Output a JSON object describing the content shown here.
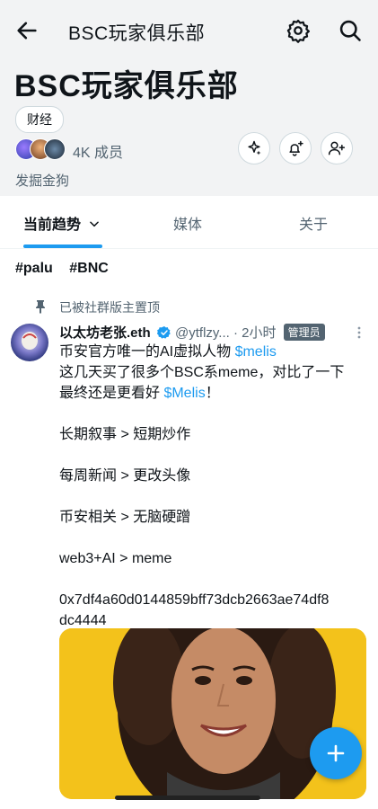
{
  "topbar": {
    "title": "BSC玩家俱乐部",
    "back_icon": "arrow-left-icon",
    "settings_icon": "gear-icon",
    "search_icon": "search-icon"
  },
  "community": {
    "name": "BSC玩家俱乐部",
    "tag": "财经",
    "members": "4K 成员",
    "description": "发掘金狗"
  },
  "tabs": [
    {
      "label": "当前趋势"
    },
    {
      "label": "媒体"
    },
    {
      "label": "关于"
    }
  ],
  "hashtags": [
    "#palu",
    "#BNC"
  ],
  "post": {
    "pinned_label": "已被社群版主置顶",
    "author": "以太坊老张.eth",
    "handle": "@ytflzy...",
    "time": "· 2小时",
    "badge": "管理员",
    "lines": {
      "l1_text": "币安官方唯一的AI虚拟人物 ",
      "l1_cashtag": "$melis",
      "l2": "这几天买了很多个BSC系meme，对比了一下",
      "l3_text": "最终还是更看好 ",
      "l3_cashtag": "$Melis",
      "l3_end": "！",
      "l4": "长期叙事 > 短期炒作",
      "l5": "每周新闻 > 更改头像",
      "l6": "币安相关 > 无脑硬蹭",
      "l7": "web3+AI > meme",
      "l8": "0x7df4a60d0144859bff73dcb2663ae74df8",
      "l9": "dc4444"
    }
  },
  "colors": {
    "accent": "#1d9bf0",
    "header_bg": "#f2f3f4",
    "muted": "#536471"
  }
}
